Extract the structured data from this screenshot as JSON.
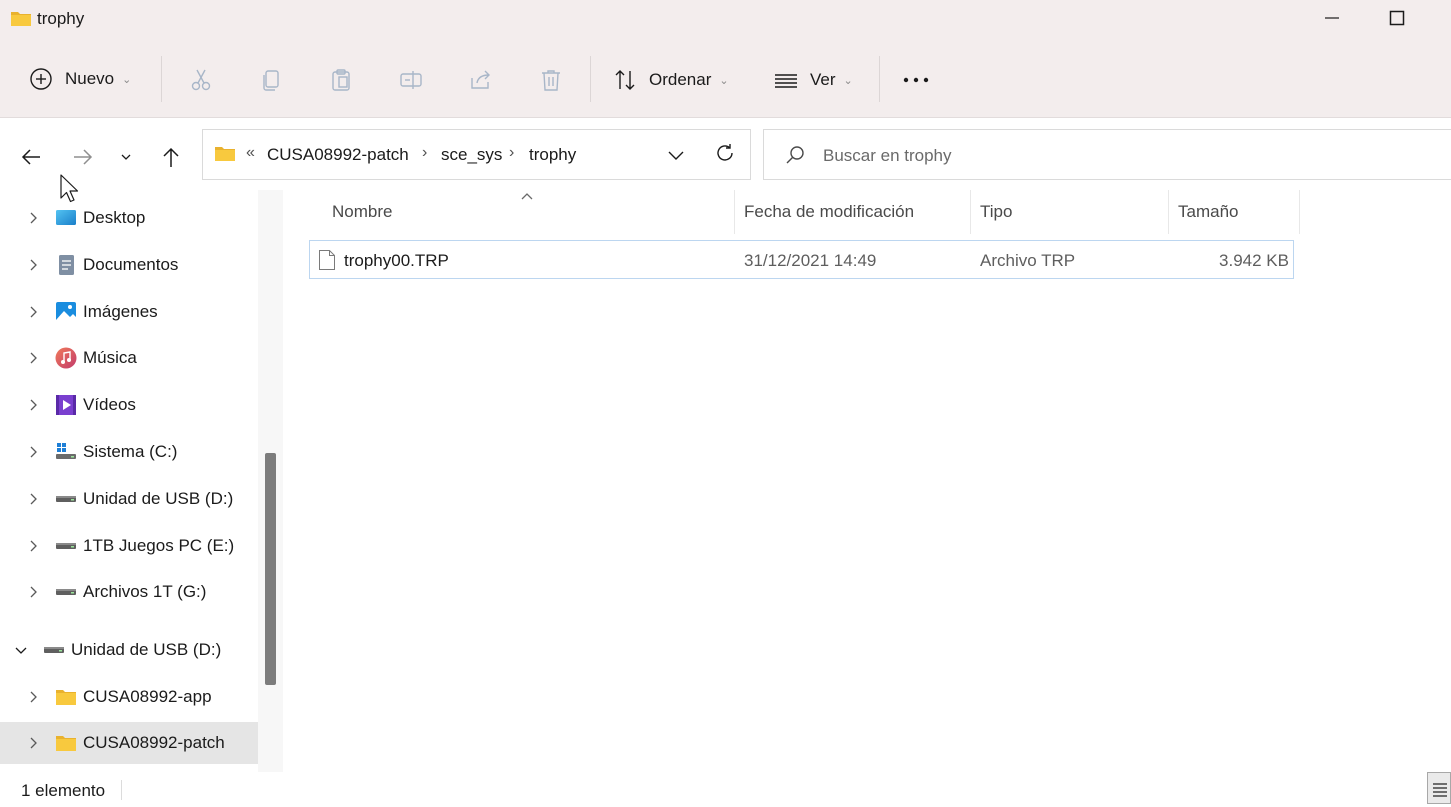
{
  "window": {
    "title": "trophy"
  },
  "commandbar": {
    "new_label": "Nuevo",
    "sort_label": "Ordenar",
    "view_label": "Ver",
    "more_label": "···"
  },
  "address": {
    "overflow": "«",
    "crumbs": [
      "CUSA08992-patch",
      "sce_sys",
      "trophy"
    ],
    "separator": "›"
  },
  "search": {
    "placeholder": "Buscar en trophy"
  },
  "sidebar": {
    "items": [
      {
        "label": "Desktop",
        "icon": "desktop-icon"
      },
      {
        "label": "Documentos",
        "icon": "documents-icon"
      },
      {
        "label": "Imágenes",
        "icon": "pictures-icon"
      },
      {
        "label": "Música",
        "icon": "music-icon"
      },
      {
        "label": "Vídeos",
        "icon": "videos-icon"
      },
      {
        "label": "Sistema (C:)",
        "icon": "system-drive-icon"
      },
      {
        "label": "Unidad de USB (D:)",
        "icon": "drive-icon"
      },
      {
        "label": "1TB Juegos PC (E:)",
        "icon": "drive-icon"
      },
      {
        "label": "Archivos 1T (G:)",
        "icon": "drive-icon"
      },
      {
        "label": "Unidad de USB (D:)",
        "icon": "drive-icon",
        "expanded": true
      },
      {
        "label": "CUSA08992-app",
        "icon": "folder-icon"
      },
      {
        "label": "CUSA08992-patch",
        "icon": "folder-icon",
        "selected": true
      }
    ]
  },
  "table": {
    "columns": [
      "Nombre",
      "Fecha de modificación",
      "Tipo",
      "Tamaño"
    ],
    "rows": [
      {
        "name": "trophy00.TRP",
        "modified": "31/12/2021 14:49",
        "type": "Archivo TRP",
        "size": "3.942 KB"
      }
    ]
  },
  "status": {
    "count": "1 elemento"
  },
  "colors": {
    "accent": "#0067c0",
    "titlebar_bg": "#f3eded",
    "selection_border": "#bcd6f0",
    "folder_yellow": "#f8c93e"
  }
}
